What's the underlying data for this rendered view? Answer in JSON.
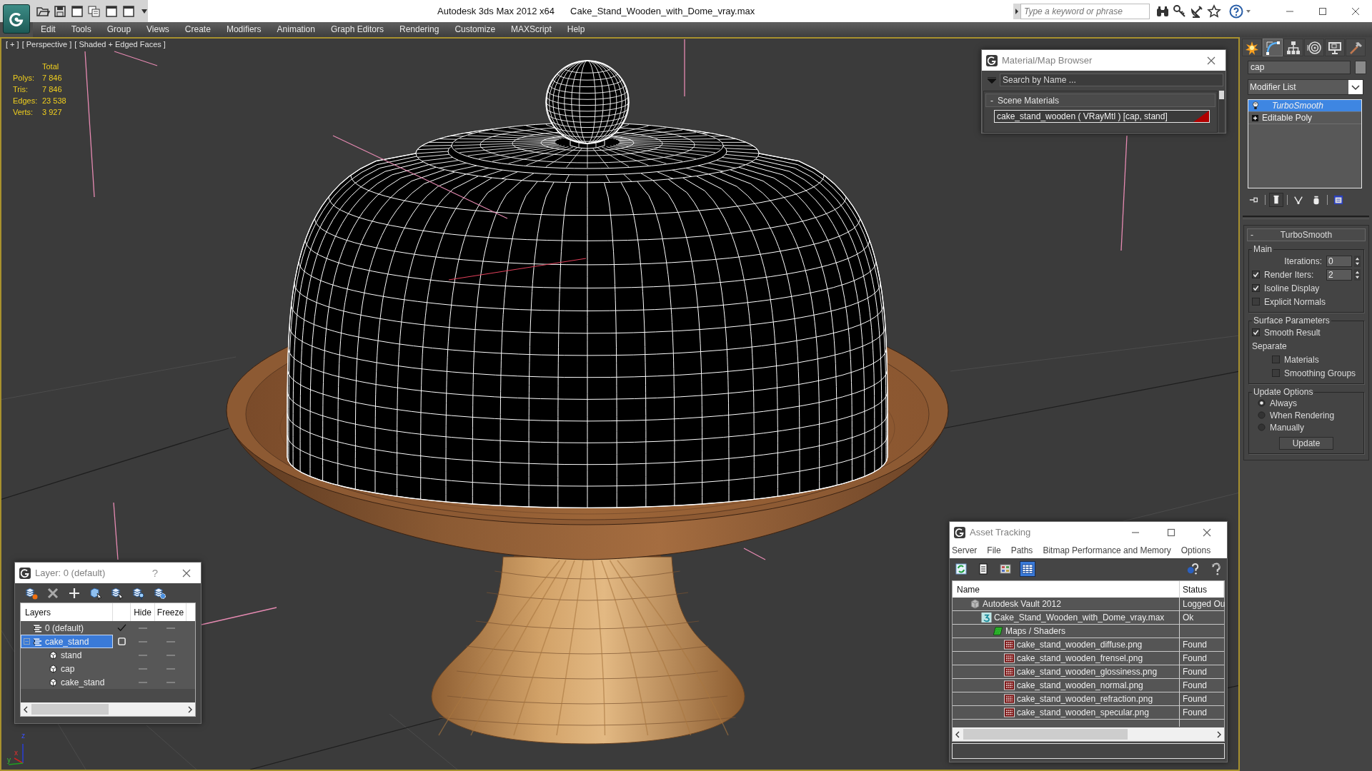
{
  "title_bar": {
    "app_title": "Autodesk 3ds Max 2012 x64",
    "file_name": "Cake_Stand_Wooden_with_Dome_vray.max",
    "search": {
      "placeholder": "Type a keyword or phrase"
    }
  },
  "menu_bar": [
    "Edit",
    "Tools",
    "Group",
    "Views",
    "Create",
    "Modifiers",
    "Animation",
    "Graph Editors",
    "Rendering",
    "Customize",
    "MAXScript",
    "Help"
  ],
  "viewport": {
    "active": true,
    "labels": [
      "[ + ]",
      "[ Perspective ]",
      "[ Shaded + Edged Faces ]"
    ],
    "stats": {
      "header": "Total",
      "rows": [
        {
          "label": "Polys:",
          "value": "7 846"
        },
        {
          "label": "Tris:",
          "value": "7 846"
        },
        {
          "label": "Edges:",
          "value": "23 538"
        },
        {
          "label": "Verts:",
          "value": "3 927"
        }
      ]
    },
    "axis_tripod": {
      "z": "z",
      "x": "x",
      "y": "y"
    }
  },
  "material_browser": {
    "title": "Material/Map Browser",
    "search": {
      "placeholder": "Search by Name ..."
    },
    "group": {
      "toggle": "-",
      "label": "Scene Materials"
    },
    "materials": [
      {
        "name": "cake_stand_wooden ( VRayMtl ) [cap, stand]",
        "color": "#b00000"
      }
    ]
  },
  "command_panel": {
    "tabs": [
      {
        "kind": "create",
        "selected": false
      },
      {
        "kind": "modify",
        "selected": true
      },
      {
        "kind": "hierarchy",
        "selected": false
      },
      {
        "kind": "motion",
        "selected": false
      },
      {
        "kind": "display",
        "selected": false
      },
      {
        "kind": "utilities",
        "selected": false
      }
    ],
    "object_name": "cap",
    "modifier_list": "Modifier List",
    "stack": [
      {
        "label": "TurboSmooth",
        "kind": "modifier",
        "selected": true
      },
      {
        "label": "Editable Poly",
        "kind": "base",
        "selected": false
      }
    ],
    "stack_tools": [
      {
        "kind": "pin",
        "on": false
      },
      {
        "kind": "end-result",
        "on": true
      },
      {
        "kind": "make-unique",
        "on": false
      },
      {
        "kind": "remove",
        "on": false
      },
      {
        "kind": "configure",
        "on": false
      }
    ],
    "rollout": {
      "toggle": "-",
      "title": "TurboSmooth",
      "groups": [
        {
          "title": "Main",
          "items": [
            {
              "kind": "spinner",
              "label": "Iterations:",
              "value": "0"
            },
            {
              "kind": "check-spinner",
              "label": "Render Iters:",
              "checked": true,
              "value": "2"
            },
            {
              "kind": "checkbox",
              "label": "Isoline Display",
              "checked": true
            },
            {
              "kind": "checkbox",
              "label": "Explicit Normals",
              "checked": false
            }
          ]
        },
        {
          "title": "Surface Parameters",
          "items": [
            {
              "kind": "checkbox",
              "label": "Smooth Result",
              "checked": true
            },
            {
              "kind": "label",
              "label": "Separate",
              "children": [
                {
                  "kind": "checkbox",
                  "label": "Materials",
                  "checked": false
                },
                {
                  "kind": "checkbox",
                  "label": "Smoothing Groups",
                  "checked": false
                }
              ]
            }
          ]
        },
        {
          "title": "Update Options",
          "items": [
            {
              "kind": "radio",
              "label": "Always",
              "selected": true
            },
            {
              "kind": "radio",
              "label": "When Rendering",
              "selected": false
            },
            {
              "kind": "radio",
              "label": "Manually",
              "selected": false
            },
            {
              "kind": "button",
              "label": "Update"
            }
          ]
        }
      ]
    }
  },
  "layer_dialog": {
    "title": "Layer: 0 (default)",
    "help": "?",
    "columns": {
      "name": "Layers",
      "hide": "Hide",
      "freeze": "Freeze"
    },
    "rows": [
      {
        "name": "0 (default)",
        "kind": "layer",
        "current": true,
        "hidden": false,
        "frozen": false,
        "selected": false
      },
      {
        "name": "cake_stand",
        "kind": "layer",
        "current": false,
        "hidden": false,
        "frozen": false,
        "selected": true,
        "expanded": true,
        "children": [
          {
            "name": "stand",
            "kind": "object",
            "hidden": false,
            "frozen": false,
            "selected": false
          },
          {
            "name": "cap",
            "kind": "object",
            "hidden": false,
            "frozen": false,
            "selected": false
          },
          {
            "name": "cake_stand",
            "kind": "object",
            "hidden": false,
            "frozen": false,
            "selected": false
          }
        ]
      }
    ]
  },
  "asset_tracking": {
    "title": "Asset Tracking",
    "menu": [
      "Server",
      "File",
      "Paths",
      "Bitmap Performance and Memory",
      "Options"
    ],
    "toolbar": [
      {
        "kind": "refresh",
        "selected": false
      },
      {
        "kind": "list",
        "selected": false
      },
      {
        "kind": "thumbnails",
        "selected": false
      },
      {
        "kind": "table",
        "selected": true
      }
    ],
    "columns": [
      "Name",
      "Status"
    ],
    "rows": [
      {
        "kind": "vault",
        "name": "Autodesk Vault 2012",
        "status": "Logged Ou",
        "children": [
          {
            "kind": "max",
            "name": "Cake_Stand_Wooden_with_Dome_vray.max",
            "status": "Ok",
            "children": [
              {
                "kind": "folder",
                "name": "Maps / Shaders",
                "children": [
                  {
                    "kind": "png",
                    "name": "cake_stand_wooden_diffuse.png",
                    "status": "Found"
                  },
                  {
                    "kind": "png",
                    "name": "cake_stand_wooden_frensel.png",
                    "status": "Found"
                  },
                  {
                    "kind": "png",
                    "name": "cake_stand_wooden_glossiness.png",
                    "status": "Found"
                  },
                  {
                    "kind": "png",
                    "name": "cake_stand_wooden_normal.png",
                    "status": "Found"
                  },
                  {
                    "kind": "png",
                    "name": "cake_stand_wooden_refraction.png",
                    "status": "Found"
                  },
                  {
                    "kind": "png",
                    "name": "cake_stand_wooden_specular.png",
                    "status": "Found"
                  }
                ]
              }
            ]
          }
        ]
      }
    ]
  }
}
